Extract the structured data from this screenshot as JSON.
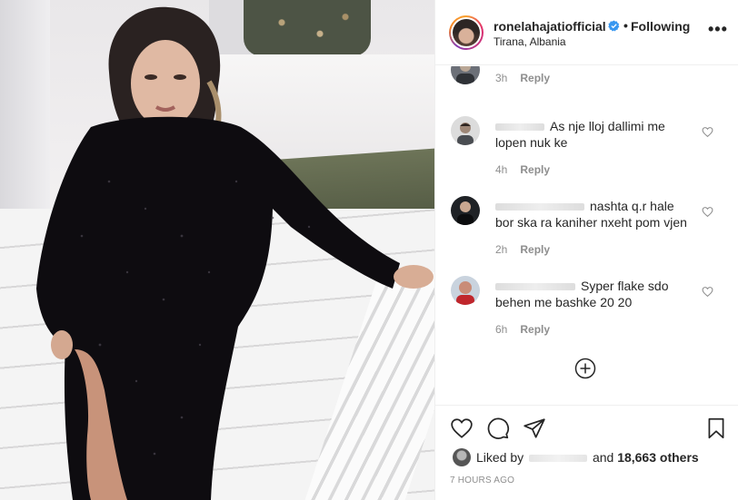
{
  "post": {
    "username": "ronelahajatiofficial",
    "separator": "•",
    "follow_status": "Following",
    "location": "Tirana, Albania",
    "more_label": "•••"
  },
  "comments": [
    {
      "text": "",
      "time": "3h",
      "reply": "Reply"
    },
    {
      "text": "As nje lloj dallimi me lopen nuk ke",
      "time": "4h",
      "reply": "Reply"
    },
    {
      "text": "nashta q.r hale bor ska ra kaniher nxeht pom vjen",
      "time": "2h",
      "reply": "Reply"
    },
    {
      "text": "Syper flake sdo behen me bashke 20 20",
      "time": "6h",
      "reply": "Reply"
    }
  ],
  "likes": {
    "prefix": "Liked by",
    "and": "and",
    "count": "18,663 others"
  },
  "timestamp": "7 HOURS AGO",
  "colors": {
    "text": "#262626",
    "muted": "#8e8e8e",
    "border": "#efefef",
    "verified": "#3897f0"
  },
  "icons": [
    "verified-icon",
    "more-options-icon",
    "heart-icon",
    "comment-icon",
    "share-icon",
    "bookmark-icon",
    "add-circle-icon"
  ]
}
